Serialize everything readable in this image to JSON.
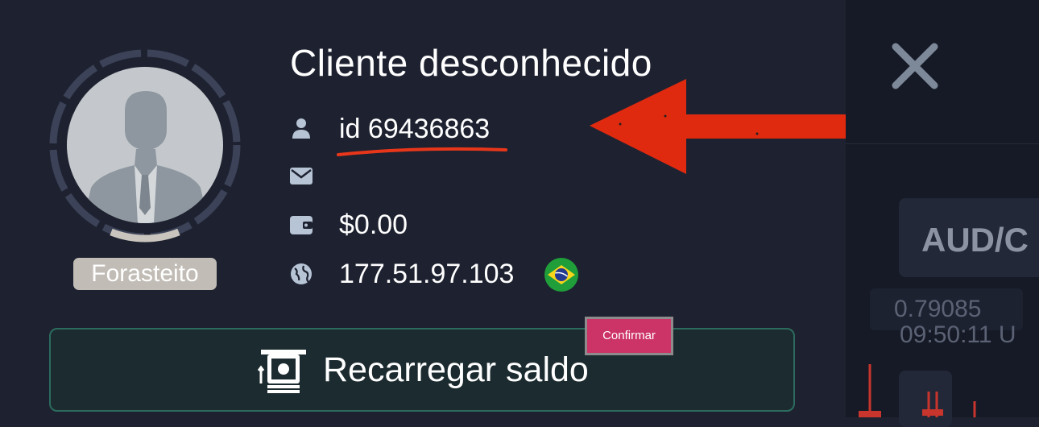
{
  "profile": {
    "title": "Cliente desconhecido",
    "id_text": "id 69436863",
    "email": "",
    "balance": "$0.00",
    "ip": "177.51.97.103",
    "status_badge": "Forasteito",
    "country_flag": "brazil-flag"
  },
  "actions": {
    "recharge_label": "Recarregar saldo",
    "confirm_label": "Confirmar",
    "close_icon": "close-icon"
  },
  "background": {
    "pair": "AUD/C",
    "price": "0.79085",
    "time": "09:50:11",
    "time_suffix": "U"
  },
  "colors": {
    "panel": "#1e2230",
    "accent_red_arrow": "#e02a0f",
    "button_border": "#2c6b5d",
    "confirm": "#cc3366"
  }
}
